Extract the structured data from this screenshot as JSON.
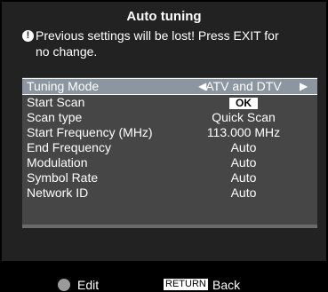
{
  "dialog": {
    "title": "Auto tuning",
    "warning_line1": "Previous settings will be lost! Press EXIT for",
    "warning_line2": "no change."
  },
  "settings": [
    {
      "label": "Tuning Mode",
      "value": "ATV and DTV",
      "selected": true
    },
    {
      "label": "Start Scan",
      "value": "OK"
    },
    {
      "label": "Scan type",
      "value": "Quick Scan"
    },
    {
      "label": "Start Frequency (MHz)",
      "value": "113.000 MHz"
    },
    {
      "label": "End Frequency",
      "value": "Auto"
    },
    {
      "label": "Modulation",
      "value": "Auto"
    },
    {
      "label": "Symbol Rate",
      "value": "Auto"
    },
    {
      "label": "Network ID",
      "value": "Auto"
    }
  ],
  "footer": {
    "edit_label": "Edit",
    "return_key": "RETURN",
    "back_label": "Back"
  },
  "icons": {
    "warning": "warning-icon",
    "edit": "dpad-icon"
  },
  "colors": {
    "selected_row": "#8c96a0",
    "list_bg": "#464646",
    "panel_bg": "#222222"
  }
}
